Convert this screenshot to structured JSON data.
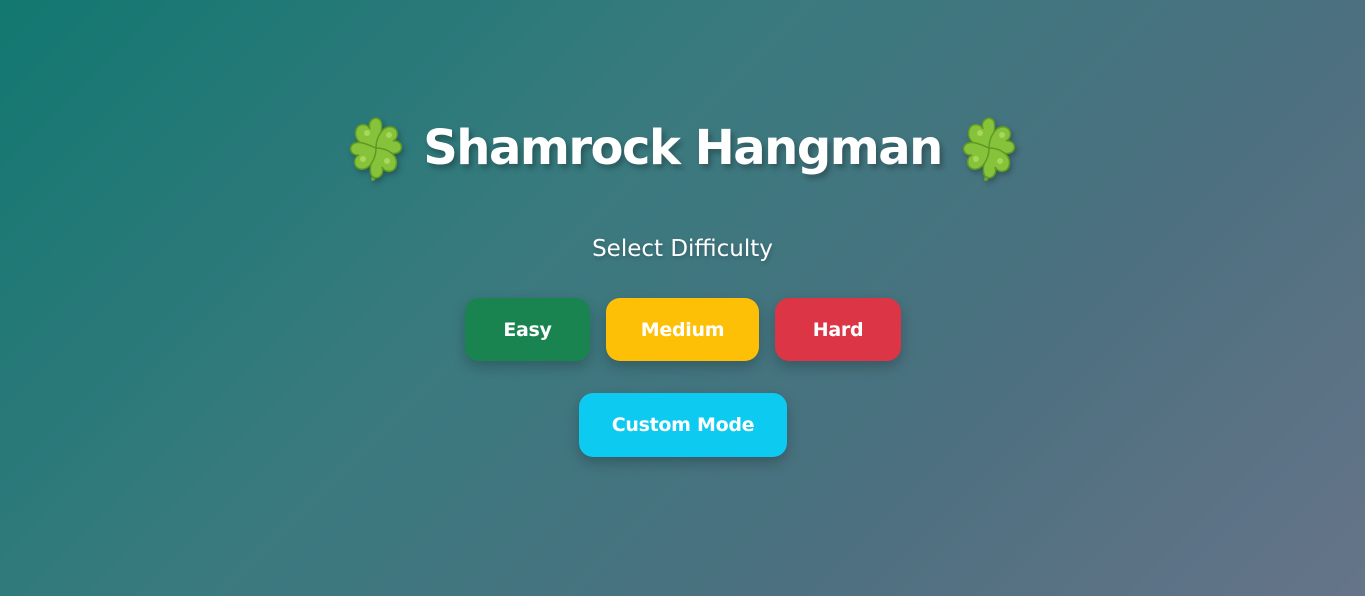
{
  "header": {
    "title": "Shamrock Hangman",
    "left_icon": "shamrock-icon",
    "right_icon": "shamrock-icon"
  },
  "difficulty": {
    "label": "Select Difficulty",
    "buttons": [
      {
        "label": "Easy",
        "color": "#1a8451"
      },
      {
        "label": "Medium",
        "color": "#fdc007"
      },
      {
        "label": "Hard",
        "color": "#dc3545"
      }
    ]
  },
  "custom": {
    "label": "Custom Mode",
    "color": "#0dcaf0"
  },
  "theme": {
    "background_start": "#127870",
    "background_end": "#667489",
    "text_color": "#ffffff",
    "shamrock_green": "#7cb82f"
  }
}
